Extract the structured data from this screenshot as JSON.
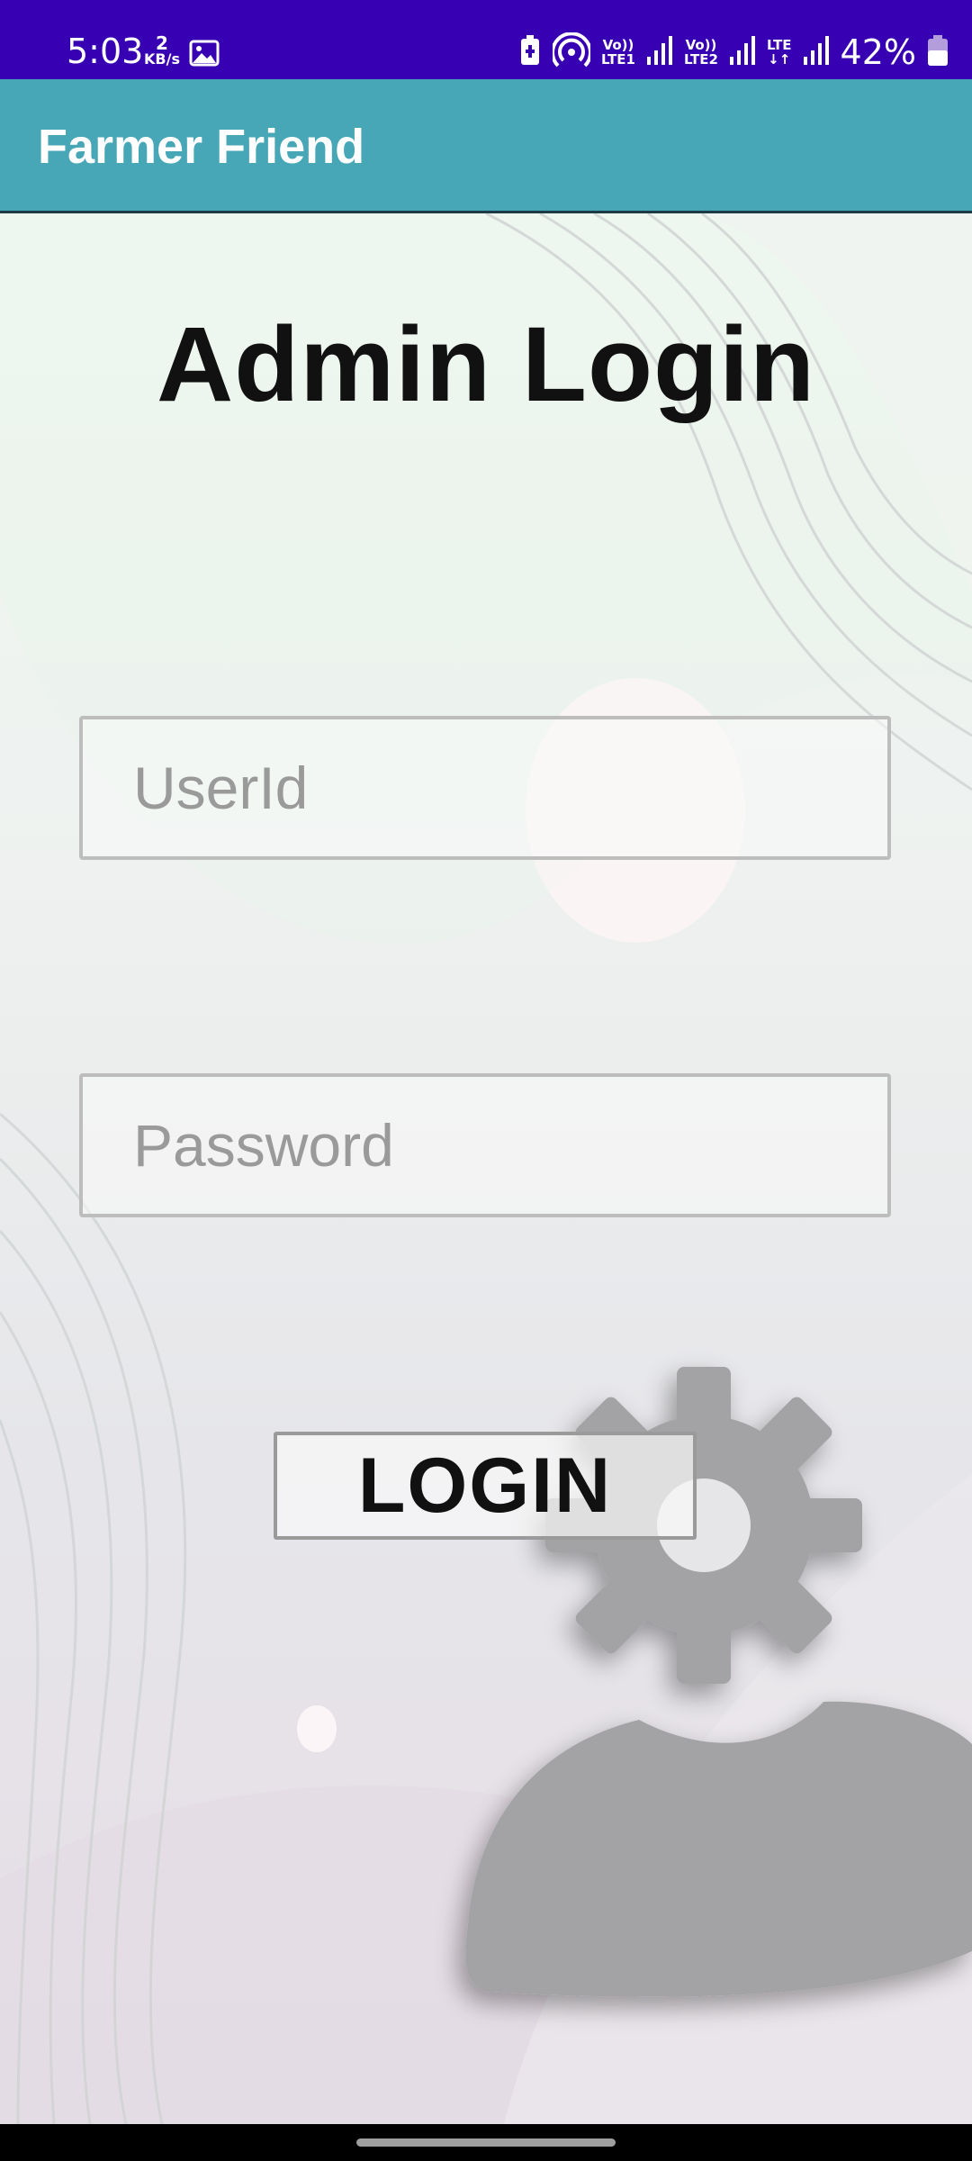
{
  "status_bar": {
    "time": "5:03",
    "net_speed_value": "2",
    "net_speed_unit": "KB/s",
    "sim1_label_top": "Vo))",
    "sim1_label_bottom": "LTE1",
    "sim2_label_top": "Vo))",
    "sim2_label_bottom": "LTE2",
    "data_label": "LTE",
    "battery_percent": "42%",
    "icons": [
      "gallery-icon",
      "battery-saver-icon",
      "hotspot-icon",
      "signal-icon",
      "battery-icon"
    ]
  },
  "app_bar": {
    "title": "Farmer Friend",
    "background_color": "#48a7b7"
  },
  "screen": {
    "heading": "Admin Login",
    "userid_placeholder": "UserId",
    "password_placeholder": "Password",
    "login_label": "LOGIN"
  },
  "colors": {
    "status_bar": "#3700b3",
    "admin_illustration": "#a3a3a5"
  }
}
